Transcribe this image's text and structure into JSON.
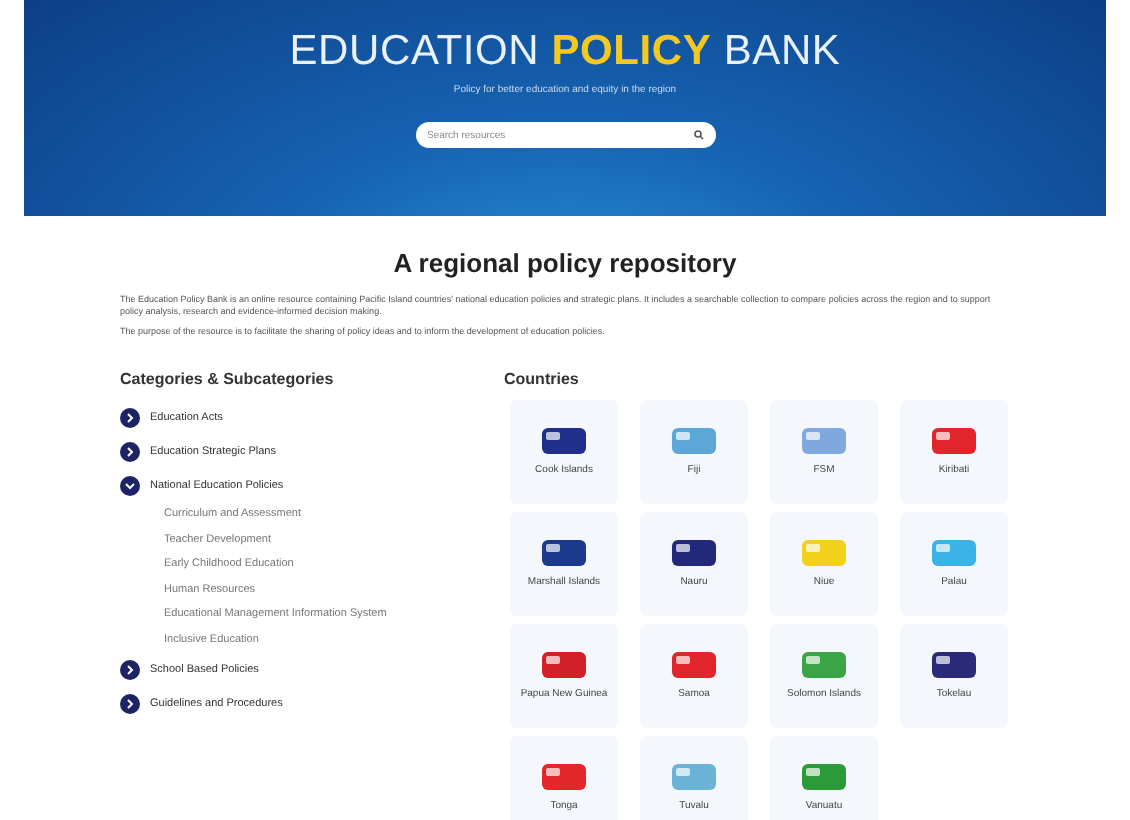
{
  "header": {
    "title_start": "EDUCATION",
    "title_highlight": "POLICY",
    "title_end": "BANK",
    "subtitle": "Policy for better education and equity in the region",
    "search": {
      "placeholder": "Search resources"
    }
  },
  "intro": {
    "heading": "A regional policy repository",
    "paragraphs": [
      "The Education Policy Bank is an online resource containing Pacific Island countries' national education policies and strategic plans. It includes a searchable collection to compare policies across the region and to support policy analysis, research and evidence-informed decision making.",
      "The purpose of the resource is to facilitate the sharing of policy ideas and to inform the development of education policies."
    ]
  },
  "categories": {
    "title": "Categories & Subcategories",
    "items": [
      {
        "label": "Education Acts",
        "expanded": false
      },
      {
        "label": "Education Strategic Plans",
        "expanded": false
      },
      {
        "label": "National Education Policies",
        "expanded": true,
        "children": [
          {
            "label": "Curriculum and Assessment"
          },
          {
            "label": "Teacher Development"
          },
          {
            "label": "Early Childhood Education"
          },
          {
            "label": "Human Resources"
          },
          {
            "label": "Educational Management Information System"
          },
          {
            "label": "Inclusive Education"
          }
        ]
      },
      {
        "label": "School Based Policies",
        "expanded": false
      },
      {
        "label": "Guidelines and Procedures",
        "expanded": false
      }
    ]
  },
  "countries": {
    "title": "Countries",
    "items": [
      {
        "name": "Cook Islands",
        "color": "#1f2f8a"
      },
      {
        "name": "Fiji",
        "color": "#5aa7d8"
      },
      {
        "name": "FSM",
        "color": "#7fa9dc"
      },
      {
        "name": "Kiribati",
        "color": "#e0262b"
      },
      {
        "name": "Marshall Islands",
        "color": "#1c3a8c"
      },
      {
        "name": "Nauru",
        "color": "#22287a"
      },
      {
        "name": "Niue",
        "color": "#f2d11c"
      },
      {
        "name": "Palau",
        "color": "#3bb3e6"
      },
      {
        "name": "Papua New Guinea",
        "color": "#d32027"
      },
      {
        "name": "Samoa",
        "color": "#e0262b"
      },
      {
        "name": "Solomon Islands",
        "color": "#3aa447"
      },
      {
        "name": "Tokelau",
        "color": "#2b2a7a"
      },
      {
        "name": "Tonga",
        "color": "#e3262a"
      },
      {
        "name": "Tuvalu",
        "color": "#6ab3d6"
      },
      {
        "name": "Vanuatu",
        "color": "#2d9a3a"
      }
    ]
  }
}
